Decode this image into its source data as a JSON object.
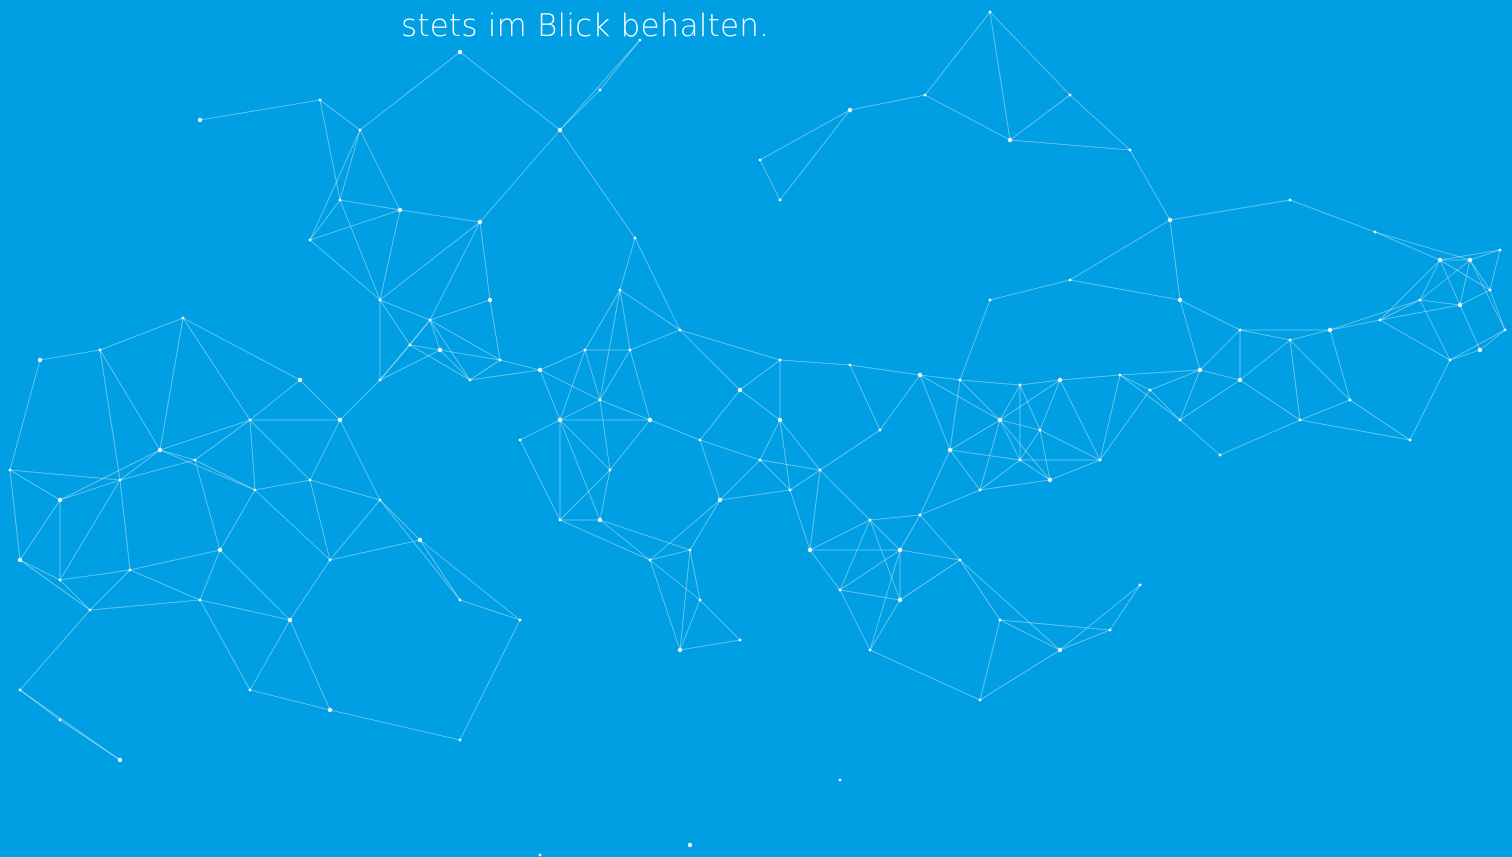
{
  "hero": {
    "tagline": "stets im Blick behalten.",
    "background_color": "#009fe3",
    "network_color": "#ffffff",
    "background_graphic": "network-graph"
  }
}
